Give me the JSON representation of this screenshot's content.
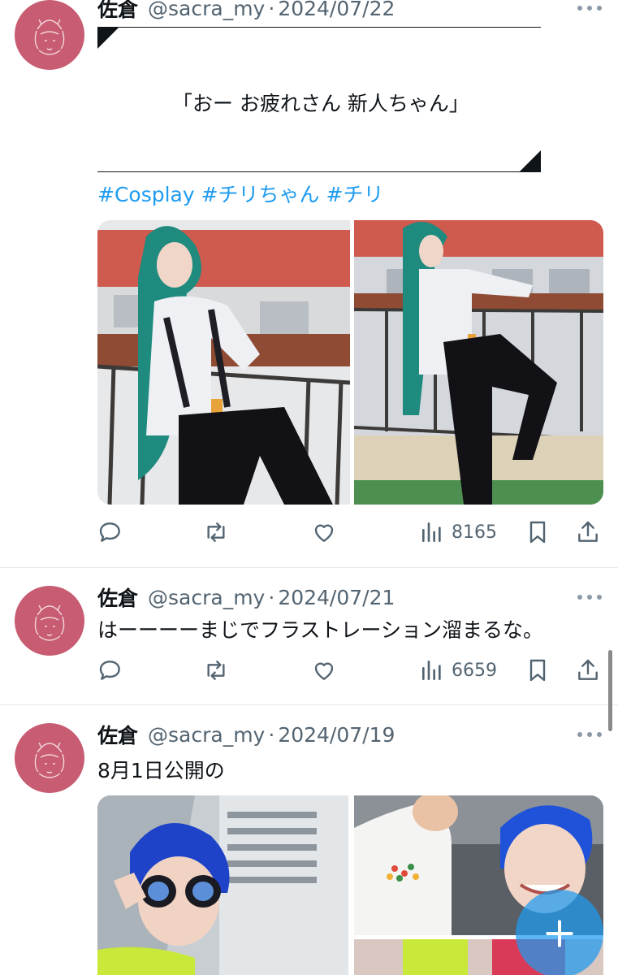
{
  "tweets": [
    {
      "name": "佐倉",
      "handle": "@sacra_my",
      "separator": "·",
      "date": "2024/07/22",
      "quote": "「おー お疲れさん 新人ちゃん」",
      "hashtags": "#Cosplay #チリちゃん #チリ",
      "views": "8165",
      "photos": [
        "cosplay-photo-green-hair-railing-sitting",
        "cosplay-photo-green-hair-railing-standing"
      ]
    },
    {
      "name": "佐倉",
      "handle": "@sacra_my",
      "separator": "·",
      "date": "2024/07/21",
      "text": "はーーーーまじでフラストレーション溜まるな。",
      "views": "6659"
    },
    {
      "name": "佐倉",
      "handle": "@sacra_my",
      "separator": "·",
      "date": "2024/07/19",
      "text": "8月1日公開の",
      "photos": [
        "cosplay-photo-blue-hair-sunglasses",
        "cosplay-photo-blue-hair-with-friend",
        "cosplay-photo-partial"
      ]
    }
  ],
  "icons": {
    "reply": "reply-icon",
    "repost": "repost-icon",
    "like": "like-icon",
    "views": "views-icon",
    "bookmark": "bookmark-icon",
    "share": "share-icon",
    "more": "more-icon",
    "compose": "compose-icon"
  },
  "colors": {
    "accent": "#1d9bf0",
    "avatar": "#c75c72",
    "muted": "#536471",
    "text": "#0f1419"
  }
}
